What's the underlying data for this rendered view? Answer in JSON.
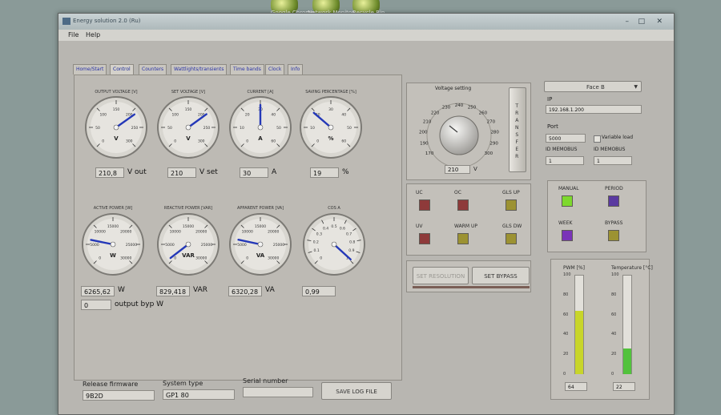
{
  "desktop": {
    "icons": [
      "Google Chrome",
      "Network Monitor",
      "Recycle Bin"
    ]
  },
  "window": {
    "title": "Energy solution 2.0 (Ru)"
  },
  "menu": [
    "File",
    "Help"
  ],
  "tabs": [
    "Home/Start",
    "Control",
    "Counters",
    "Wattlights/transients",
    "Time bands",
    "Clock",
    "Info"
  ],
  "gauges_top": [
    {
      "title": "OUTPUT VOLTAGE [V]",
      "unit": "V",
      "value_field": "210,8",
      "field_unit": "V out",
      "ticks": [
        "0",
        "50",
        "100",
        "150",
        "200",
        "250",
        "300"
      ],
      "value": 210.8,
      "max": 300
    },
    {
      "title": "SET VOLTAGE [V]",
      "unit": "V",
      "value_field": "210",
      "field_unit": "V set",
      "ticks": [
        "0",
        "50",
        "100",
        "150",
        "200",
        "250",
        "300"
      ],
      "value": 210,
      "max": 300
    },
    {
      "title": "CURRENT [A]",
      "unit": "A",
      "value_field": "30",
      "field_unit": "A",
      "ticks": [
        "0",
        "10",
        "20",
        "30",
        "40",
        "50",
        "60"
      ],
      "value": 30,
      "max": 60
    },
    {
      "title": "SAVING PERCENTAGE [%]",
      "unit": "%",
      "value_field": "19",
      "field_unit": "%",
      "ticks": [
        "0",
        "10",
        "20",
        "30",
        "40",
        "50",
        "60"
      ],
      "value": 19,
      "max": 60
    }
  ],
  "gauges_bottom": [
    {
      "title": "ACTIVE POWER [W]",
      "unit": "W",
      "value_field": "6265,62",
      "field_unit": "W",
      "ticks": [
        "0",
        "5000",
        "10000",
        "15000",
        "20000",
        "25000",
        "30000"
      ],
      "value": 6265.62,
      "max": 30000
    },
    {
      "title": "REACTIVE POWER [VAR]",
      "unit": "VAR",
      "value_field": "829,418",
      "field_unit": "VAR",
      "ticks": [
        "0",
        "5000",
        "10000",
        "15000",
        "20000",
        "25000",
        "30000"
      ],
      "value": 829.418,
      "max": 30000
    },
    {
      "title": "APPARENT POWER [VA]",
      "unit": "VA",
      "value_field": "6320,28",
      "field_unit": "VA",
      "ticks": [
        "0",
        "5000",
        "10000",
        "15000",
        "20000",
        "25000",
        "30000"
      ],
      "value": 6320.28,
      "max": 30000
    },
    {
      "title": "COS A",
      "unit": "",
      "value_field": "0,99",
      "field_unit": "",
      "ticks": [
        "0",
        "0.1",
        "0.2",
        "0.3",
        "0.4",
        "0.5",
        "0.6",
        "0.7",
        "0.8",
        "0.9",
        "1"
      ],
      "value": 0.99,
      "max": 1
    }
  ],
  "output_bypass": {
    "value": "0",
    "label": "output byp W"
  },
  "voltage_setting": {
    "title": "Voltage setting",
    "ticks": [
      "170",
      "190",
      "200",
      "210",
      "220",
      "230",
      "240",
      "250",
      "260",
      "270",
      "280",
      "290",
      "300"
    ],
    "value": "210",
    "unit": "V",
    "button_letters": [
      "T",
      "R",
      "A",
      "N",
      "S",
      "F",
      "E",
      "R"
    ]
  },
  "alarms": [
    {
      "label": "UC",
      "color": "#8e3a3a"
    },
    {
      "label": "OC",
      "color": "#8e3a3a"
    },
    {
      "label": "GLS UP",
      "color": "#9c9232"
    },
    {
      "label": "UV",
      "color": "#8e3a3a"
    },
    {
      "label": "WARM UP",
      "color": "#9c9232"
    },
    {
      "label": "GLS DW",
      "color": "#9c9232"
    }
  ],
  "buttons": {
    "set_resolution": "SET RESOLUTION",
    "set_bypass": "SET BYPASS",
    "save_log": "SAVE LOG FILE"
  },
  "connection": {
    "dropdown": "Face B",
    "ip_label": "IP",
    "ip_value": "192.168.1.200",
    "port_label": "Port",
    "port_value": "5000",
    "variable_load": "Variable load",
    "memobus_label_1": "ID MEMOBUS",
    "memobus_label_2": "ID MEMOBUS",
    "memobus_value_1": "1",
    "memobus_value_2": "1"
  },
  "modes": [
    {
      "label": "MANUAL",
      "color": "#7ed92e"
    },
    {
      "label": "PERIOD",
      "color": "#5a3aa0"
    },
    {
      "label": "WEEK",
      "color": "#7a34b8"
    },
    {
      "label": "BYPASS",
      "color": "#9c9232"
    }
  ],
  "bars": [
    {
      "title": "PWM [%]",
      "ticks": [
        "100",
        "80",
        "60",
        "40",
        "20",
        "0"
      ],
      "fraction": 0.64,
      "value": "64",
      "color": "#c8d52a"
    },
    {
      "title": "Temperature [°C]",
      "ticks": [
        "100",
        "80",
        "60",
        "40",
        "20",
        "0"
      ],
      "fraction": 0.26,
      "value": "22",
      "color": "#52c23c"
    }
  ],
  "footer": {
    "release_label": "Release firmware",
    "release_value": "9B2D",
    "system_label": "System type",
    "system_value": "GP1 80",
    "serial_label": "Serial number",
    "serial_value": ""
  }
}
